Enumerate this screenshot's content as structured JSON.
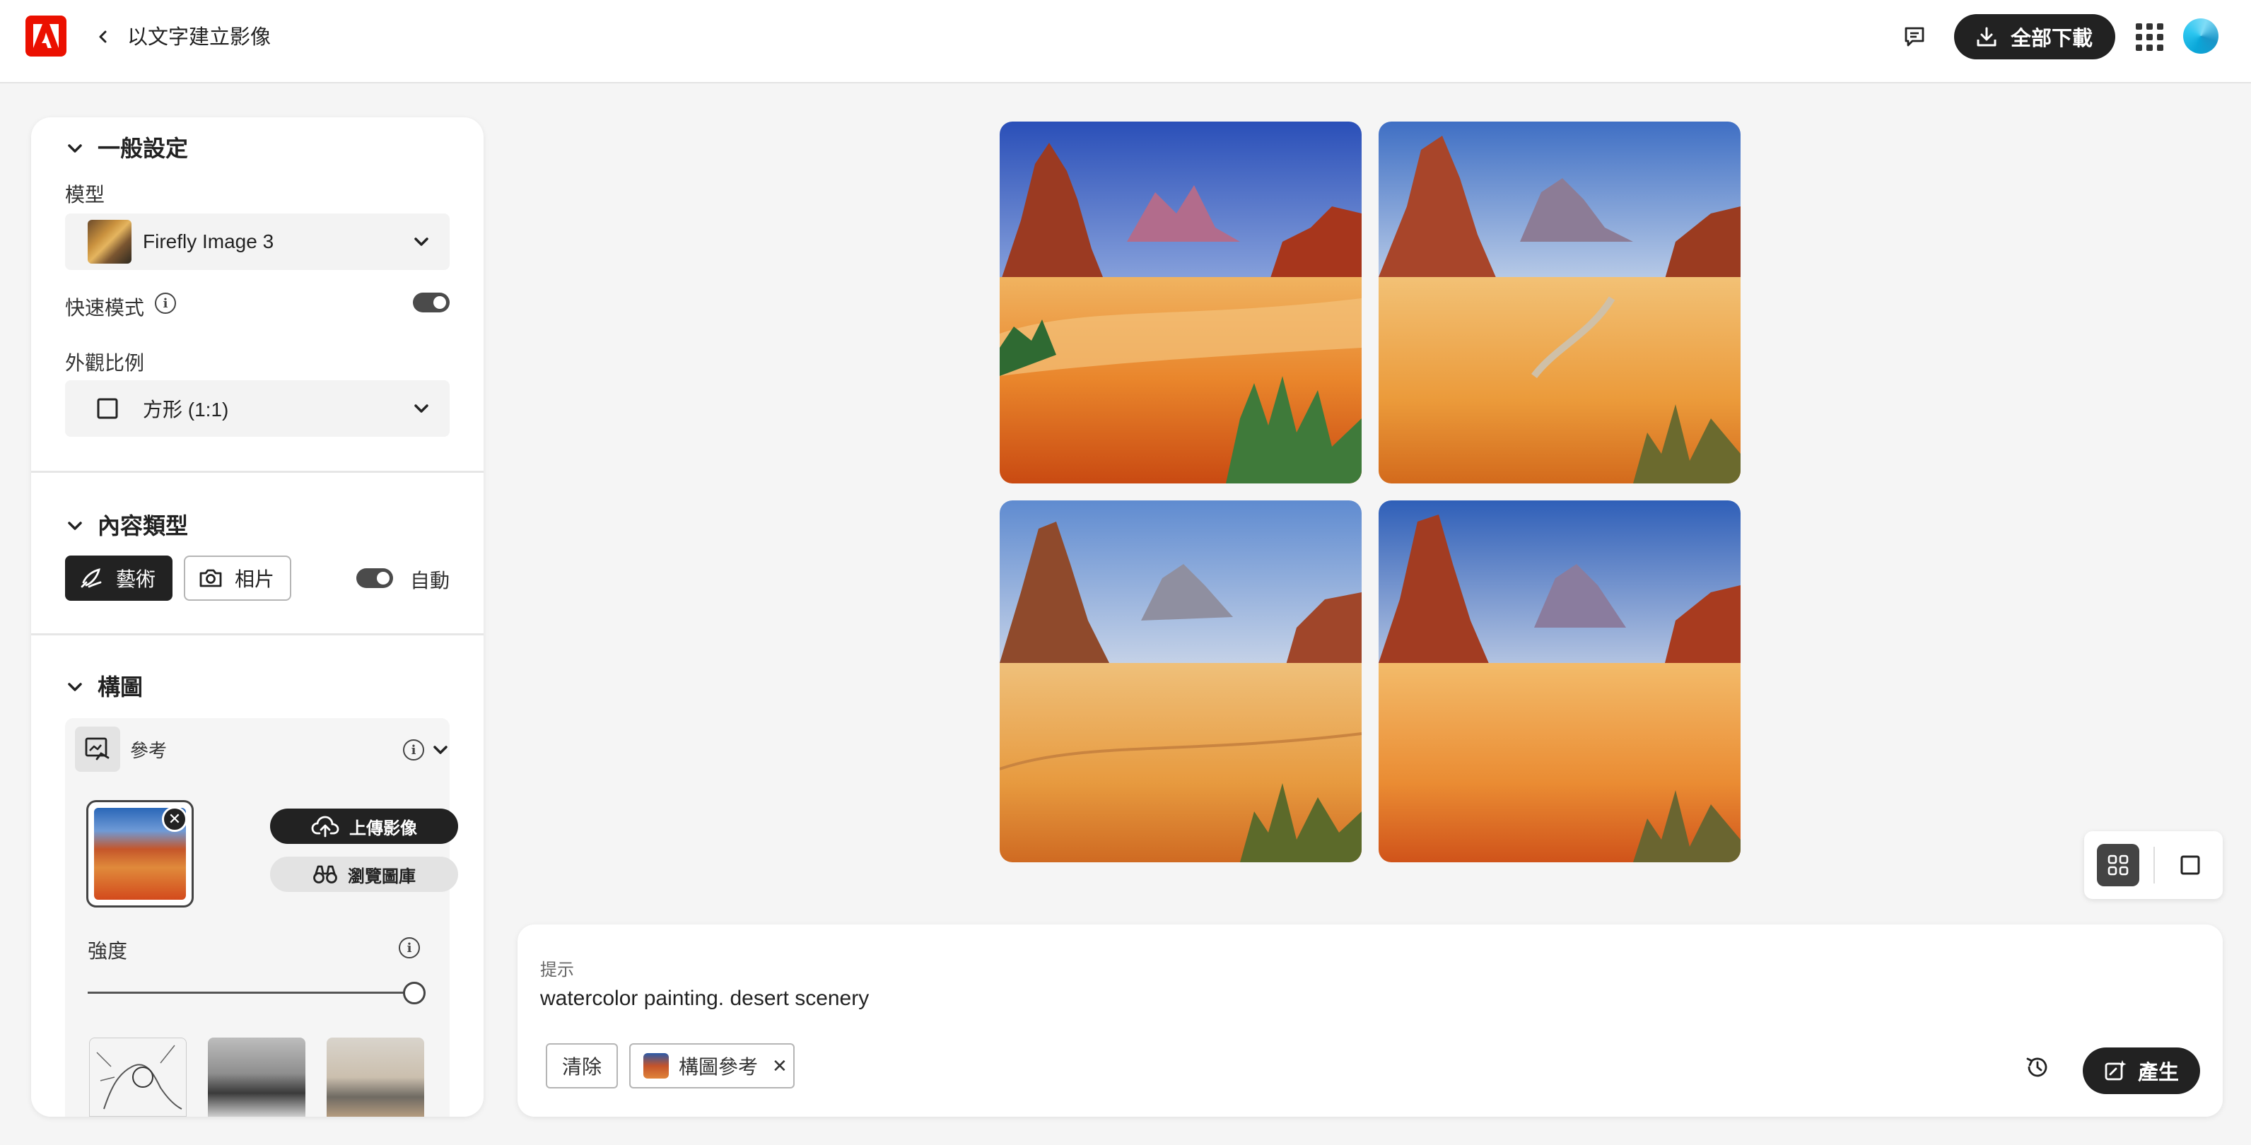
{
  "header": {
    "title": "以文字建立影像",
    "download_all_label": "全部下載",
    "icons": [
      "adobe-logo",
      "back-chevron",
      "feedback-icon",
      "download-icon",
      "apps-grid-icon",
      "avatar"
    ]
  },
  "general_settings": {
    "title": "一般設定",
    "model_label": "模型",
    "model_value": "Firefly Image 3",
    "fast_mode_label": "快速模式",
    "fast_mode_on": true,
    "aspect_label": "外觀比例",
    "aspect_value": "方形 (1:1)"
  },
  "content_type": {
    "title": "內容類型",
    "art_label": "藝術",
    "photo_label": "相片",
    "auto_label": "自動",
    "selected": "藝術",
    "auto_on": true
  },
  "composition": {
    "title": "構圖",
    "reference_label": "參考",
    "upload_label": "上傳影像",
    "browse_label": "瀏覽圖庫",
    "strength_label": "強度",
    "strength_value": 1.0
  },
  "images": {
    "count": 4
  },
  "prompt": {
    "label": "提示",
    "text": "watercolor painting. desert scenery",
    "clear_label": "清除",
    "chip_label": "構圖參考",
    "generate_label": "產生"
  },
  "colors": {
    "brand": "#eb1000",
    "dark": "#222222",
    "panel": "#ffffff",
    "background": "#f5f5f5"
  }
}
